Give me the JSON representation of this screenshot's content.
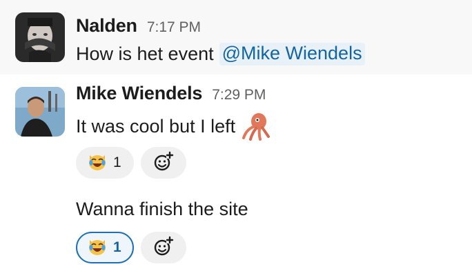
{
  "messages": [
    {
      "author": "Nalden",
      "time": "7:17 PM",
      "text": "How is het event",
      "mention": "@Mike Wiendels"
    },
    {
      "author": "Mike Wiendels",
      "time": "7:29 PM",
      "text": "It was cool but I left",
      "emoji": "squid-emoji",
      "reaction": {
        "emoji": "crying-laughing-cat-emoji",
        "count": "1"
      }
    },
    {
      "text": "Wanna finish the site",
      "reaction": {
        "emoji": "crying-laughing-cat-emoji",
        "count": "1",
        "reacted_by_me": true
      }
    }
  ],
  "colors": {
    "hover_bg": "#f8f8f8",
    "mention_bg": "#e8f1f7",
    "mention_text": "#1264a3",
    "reaction_bg": "#f0f0f0",
    "reaction_mine_border": "#1d6fb8"
  },
  "icons": [
    "add-reaction-icon",
    "squid-emoji",
    "crying-laughing-cat-emoji"
  ]
}
